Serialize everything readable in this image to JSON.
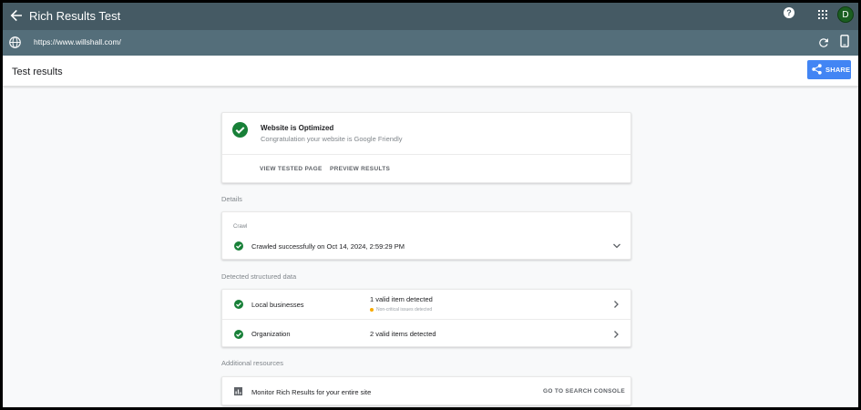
{
  "app": {
    "title": "Rich Results Test",
    "avatar_initial": "D",
    "help_glyph": "?"
  },
  "url_bar": {
    "url": "https://www.willshall.com/"
  },
  "subheader": {
    "title": "Test results",
    "share_label": "SHARE"
  },
  "summary": {
    "title": "Website is Optimized",
    "subtitle": "Congratulation your website is Google Friendly",
    "actions": [
      "VIEW TESTED PAGE",
      "PREVIEW RESULTS"
    ]
  },
  "details": {
    "label": "Details",
    "crawl_heading": "Crawl",
    "crawl_text": "Crawled successfully on Oct 14, 2024, 2:59:29 PM"
  },
  "structured_data": {
    "label": "Detected structured data",
    "rows": [
      {
        "name": "Local businesses",
        "count": "1 valid item detected",
        "note": "Non-critical issues detected"
      },
      {
        "name": "Organization",
        "count": "2 valid items detected"
      }
    ]
  },
  "resources": {
    "label": "Additional resources",
    "text": "Monitor Rich Results for your entire site",
    "link": "GO TO SEARCH CONSOLE"
  },
  "colors": {
    "appbar": "#455a64",
    "urlbar": "#546e7a",
    "accent": "#4285f4",
    "success": "#188038",
    "warning": "#f9ab00"
  },
  "icons": [
    "back-arrow-icon",
    "help-icon",
    "apps-grid-icon",
    "globe-icon",
    "reload-icon",
    "mobile-device-icon",
    "share-icon",
    "check-circle-icon",
    "chevron-down-icon",
    "chevron-right-icon",
    "bar-chart-icon"
  ]
}
